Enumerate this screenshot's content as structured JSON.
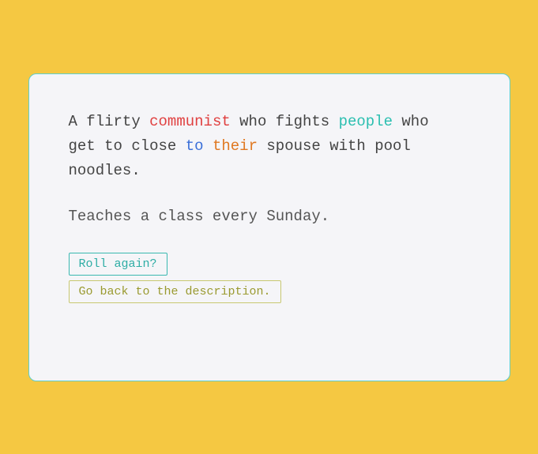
{
  "card": {
    "line1": {
      "parts": [
        {
          "text": "A flirty ",
          "class": "word-default"
        },
        {
          "text": "communist",
          "class": "word-red"
        },
        {
          "text": " who fights ",
          "class": "word-default"
        },
        {
          "text": "people",
          "class": "word-teal"
        },
        {
          "text": " who",
          "class": "word-default"
        }
      ]
    },
    "line2": {
      "parts": [
        {
          "text": "get ",
          "class": "word-default"
        },
        {
          "text": "to",
          "class": "word-default"
        },
        {
          "text": " close ",
          "class": "word-default"
        },
        {
          "text": "to",
          "class": "word-blue"
        },
        {
          "text": " ",
          "class": "word-default"
        },
        {
          "text": "their",
          "class": "word-orange"
        },
        {
          "text": " spouse with pool",
          "class": "word-default"
        }
      ]
    },
    "line3": {
      "text": "noodles."
    },
    "secondary_text": "Teaches a class every Sunday.",
    "btn_roll": "Roll again?",
    "btn_back": "Go back to the description."
  }
}
